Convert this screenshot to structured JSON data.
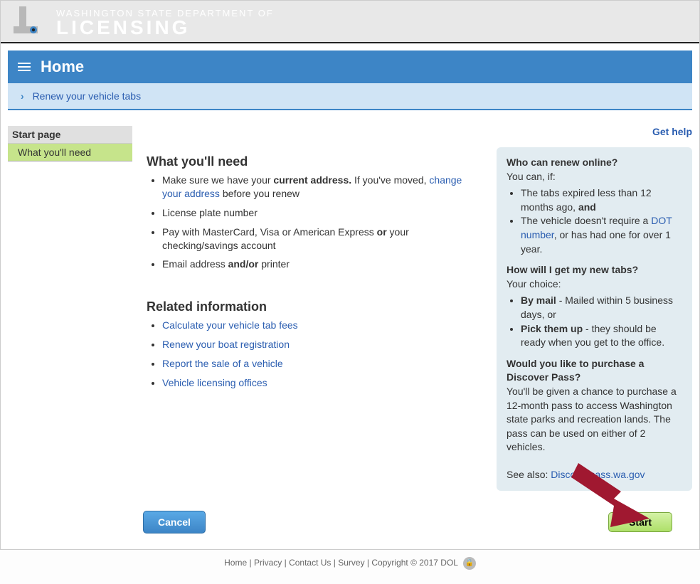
{
  "header": {
    "dept_line": "WASHINGTON STATE DEPARTMENT OF",
    "dept_main": "LICENSING"
  },
  "title_bar": {
    "title": "Home"
  },
  "breadcrumb": {
    "label": "Renew your vehicle tabs"
  },
  "leftnav": {
    "heading": "Start page",
    "item": "What you'll need"
  },
  "main": {
    "need_heading": "What you'll need",
    "need_items": {
      "i0_pre": "Make sure we have your ",
      "i0_bold": "current address.",
      "i0_post": " If you've moved, ",
      "i0_link": "change your address",
      "i0_after": " before you renew",
      "i1": "License plate number",
      "i2_pre": "Pay with MasterCard, Visa or American Express ",
      "i2_bold": "or",
      "i2_post": " your checking/savings account",
      "i3_pre": "Email address ",
      "i3_bold": "and/or",
      "i3_post": " printer"
    },
    "related_heading": "Related information",
    "related_links": {
      "r0": "Calculate your vehicle tab fees",
      "r1": "Renew your boat registration",
      "r2": "Report the sale of a vehicle",
      "r3": "Vehicle licensing offices"
    }
  },
  "right": {
    "get_help": "Get help",
    "who_heading": "Who can renew online?",
    "who_intro": "You can, if:",
    "who_i0_pre": "The tabs expired less than 12 months ago, ",
    "who_i0_bold": "and",
    "who_i1_pre": "The vehicle doesn't require a ",
    "who_i1_link": "DOT number",
    "who_i1_post": ", or has had one for over 1 year.",
    "how_heading": "How will I get my new tabs?",
    "how_intro": "Your choice:",
    "how_i0_bold": "By mail",
    "how_i0_post": " - Mailed within 5 business days, or",
    "how_i1_bold": "Pick them up",
    "how_i1_post": " - they should be ready when you get to the office.",
    "dp_heading": "Would you like to purchase a Discover Pass?",
    "dp_body": "You'll be given a chance to purchase a 12-month pass to access Washington state parks and recreation lands. The pass can be used on either of 2 vehicles.",
    "see_also_label": "See also: ",
    "see_also_link": "Discoverpass.wa.gov"
  },
  "buttons": {
    "cancel": "Cancel",
    "start": "Start"
  },
  "footer": {
    "home": "Home",
    "privacy": "Privacy",
    "contact": "Contact Us",
    "survey": "Survey",
    "copyright": "Copyright © 2017 DOL"
  }
}
